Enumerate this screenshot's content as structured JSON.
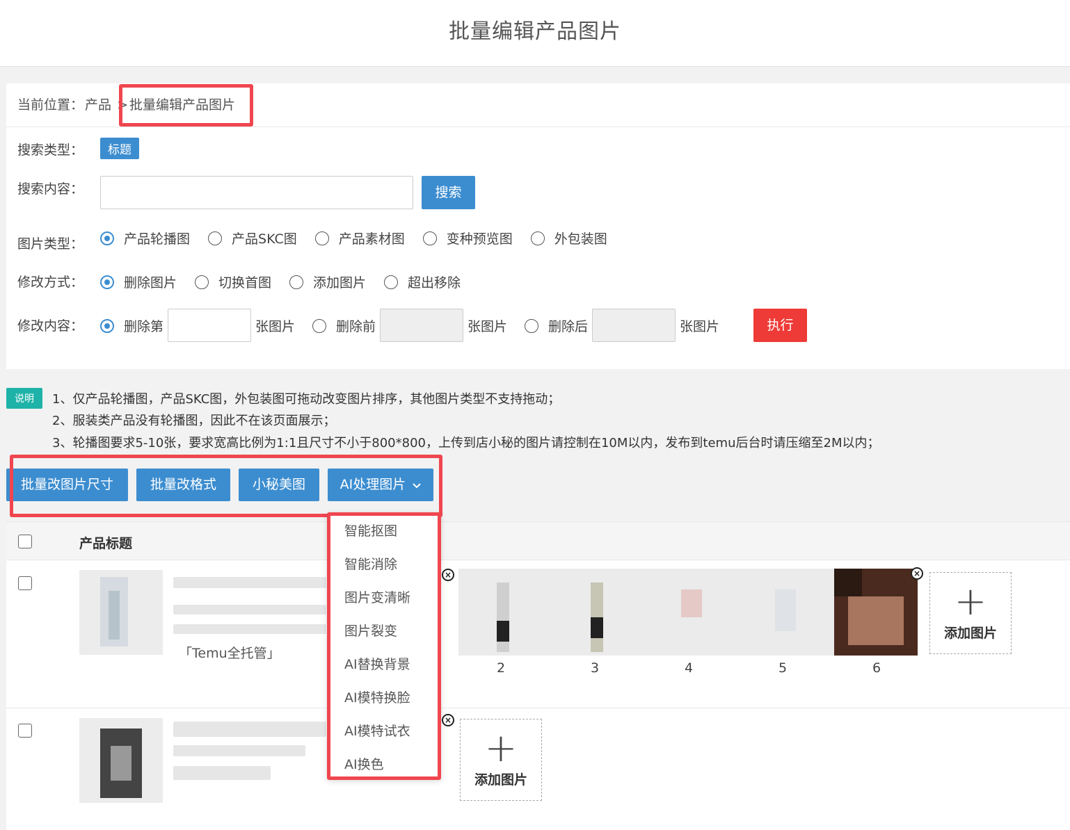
{
  "header": {
    "title": "批量编辑产品图片"
  },
  "breadcrumb": {
    "prefix": "当前位置：",
    "parent": "产品",
    "separator": ">",
    "current": "批量编辑产品图片"
  },
  "search": {
    "type_label": "搜索类型：",
    "type_value": "标题",
    "content_label": "搜索内容：",
    "content_value": "",
    "search_button": "搜索"
  },
  "image_type": {
    "label": "图片类型：",
    "options": [
      "产品轮播图",
      "产品SKC图",
      "产品素材图",
      "变种预览图",
      "外包装图"
    ],
    "selected": 0
  },
  "modify_mode": {
    "label": "修改方式：",
    "options": [
      "删除图片",
      "切换首图",
      "添加图片",
      "超出移除"
    ],
    "selected": 0
  },
  "modify_content": {
    "label": "修改内容：",
    "opt1": "删除第",
    "opt2": "删除前",
    "opt3": "删除后",
    "unit": "张图片",
    "execute_button": "执行"
  },
  "notes": {
    "tag": "说明",
    "lines": [
      "1、仅产品轮播图，产品SKC图，外包装图可拖动改变图片排序，其他图片类型不支持拖动；",
      "2、服装类产品没有轮播图，因此不在该页面展示；",
      "3、轮播图要求5-10张，要求宽高比例为1:1且尺寸不小于800*800，上传到店小秘的图片请控制在10M以内，发布到temu后台时请压缩至2M以内；"
    ]
  },
  "toolbar": {
    "resize": "批量改图片尺寸",
    "format": "批量改格式",
    "beautify": "小秘美图",
    "ai": "AI处理图片"
  },
  "ai_menu": [
    "智能抠图",
    "智能消除",
    "图片变清晰",
    "图片裂变",
    "AI替换背景",
    "AI模特换脸",
    "AI模特试衣",
    "AI换色"
  ],
  "table": {
    "header_title": "产品标题",
    "row1": {
      "tag": "「Temu全托管」",
      "image_numbers": [
        "2",
        "3",
        "4",
        "5",
        "6"
      ],
      "add_label": "添加图片"
    },
    "row2": {
      "add_label": "添加图片"
    }
  },
  "colors": {
    "primary": "#3c8dd0",
    "danger": "#ee3b37",
    "highlight": "#f0464f",
    "note": "#1eb3a8"
  }
}
